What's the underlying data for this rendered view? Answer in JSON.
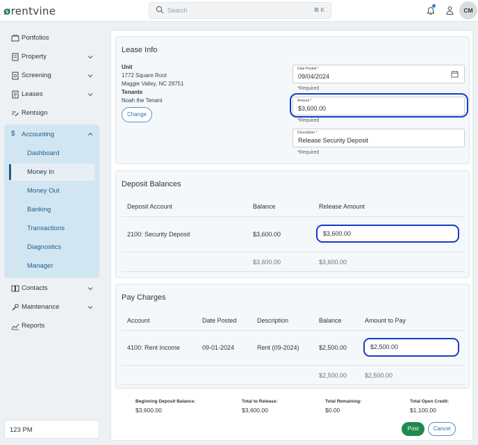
{
  "app": {
    "logo_text": "rentvine"
  },
  "search": {
    "placeholder": "Search",
    "shortcut": "⌘ K"
  },
  "header": {
    "avatar_initials": "CM"
  },
  "sidebar": {
    "items": [
      {
        "label": "Portfolios",
        "icon": "portfolios-icon"
      },
      {
        "label": "Property",
        "icon": "building-icon"
      },
      {
        "label": "Screening",
        "icon": "screening-icon"
      },
      {
        "label": "Leases",
        "icon": "lease-icon"
      },
      {
        "label": "Rentsign",
        "icon": "signature-icon"
      },
      {
        "label": "Accounting",
        "icon": "dollar-icon"
      },
      {
        "label": "Contacts",
        "icon": "contacts-icon"
      },
      {
        "label": "Maintenance",
        "icon": "wrench-icon"
      },
      {
        "label": "Reports",
        "icon": "chart-icon"
      }
    ],
    "accounting_sub": [
      "Dashboard",
      "Money In",
      "Money Out",
      "Banking",
      "Transactions",
      "Diagnostics",
      "Manager"
    ],
    "active_sub": "Money In",
    "time": "123 PM"
  },
  "lease_info": {
    "title": "Lease Info",
    "unit_label": "Unit",
    "address_line1": "1772 Square Root",
    "address_line2": "Maggie Valley, NC 28751",
    "tenants_label": "Tenants",
    "tenant_name": "Noah the Tenant",
    "change_label": "Change",
    "date_label": "Date Posted",
    "date_value": "09/04/2024",
    "amount_label": "Amount",
    "amount_value": "$3,600.00",
    "description_label": "Description",
    "description_value": "Release Security Deposit",
    "required_text": "Required",
    "required_marker": "*"
  },
  "deposit_balances": {
    "title": "Deposit Balances",
    "columns": [
      "Deposit Account",
      "Balance",
      "Release Amount"
    ],
    "rows": [
      {
        "account": "2100: Security Deposit",
        "balance": "$3,600.00",
        "release": "$3,600.00"
      }
    ],
    "totals": {
      "balance": "$3,600.00",
      "release": "$3,600.00"
    }
  },
  "pay_charges": {
    "title": "Pay Charges",
    "columns": [
      "Account",
      "Date Posted",
      "Description",
      "Balance",
      "Amount to Pay"
    ],
    "rows": [
      {
        "account": "4100: Rent Income",
        "date": "09-01-2024",
        "description": "Rent (09-2024)",
        "balance": "$2,500.00",
        "amount": "$2,500.00"
      }
    ],
    "totals": {
      "balance": "$2,500.00",
      "amount": "$2,500.00"
    }
  },
  "summary": {
    "beginning_label": "Beginning Deposit Balance:",
    "beginning_value": "$3,600.00",
    "release_label": "Total to Release:",
    "release_value": "$3,600.00",
    "remaining_label": "Total Remaining:",
    "remaining_value": "$0.00",
    "credit_label": "Total Open Credit:",
    "credit_value": "$1,100.00"
  },
  "actions": {
    "post_label": "Post",
    "cancel_label": "Cancel"
  },
  "colors": {
    "accent_green": "#1f8a4c",
    "highlight_ring": "#1739c9",
    "nav_blue": "#1d5e8a"
  }
}
